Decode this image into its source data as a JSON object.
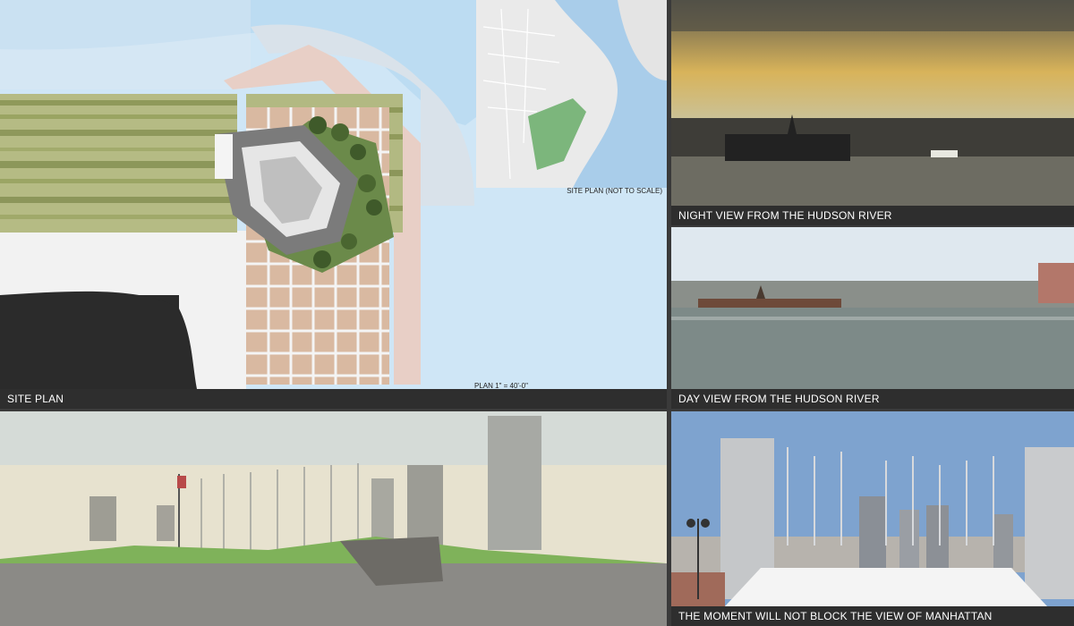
{
  "panels": {
    "site_plan": {
      "caption": "SITE PLAN",
      "scale_label": "PLAN  1\" = 40'-0\"",
      "inset_caption": "SITE PLAN (NOT TO SCALE)"
    },
    "night_view": {
      "caption": "NIGHT VIEW FROM THE HUDSON RIVER"
    },
    "day_view": {
      "caption": "DAY VIEW FROM THE HUDSON RIVER"
    },
    "manhattan_view": {
      "caption": "THE MOMENT WILL NOT BLOCK THE VIEW OF MANHATTAN"
    }
  }
}
